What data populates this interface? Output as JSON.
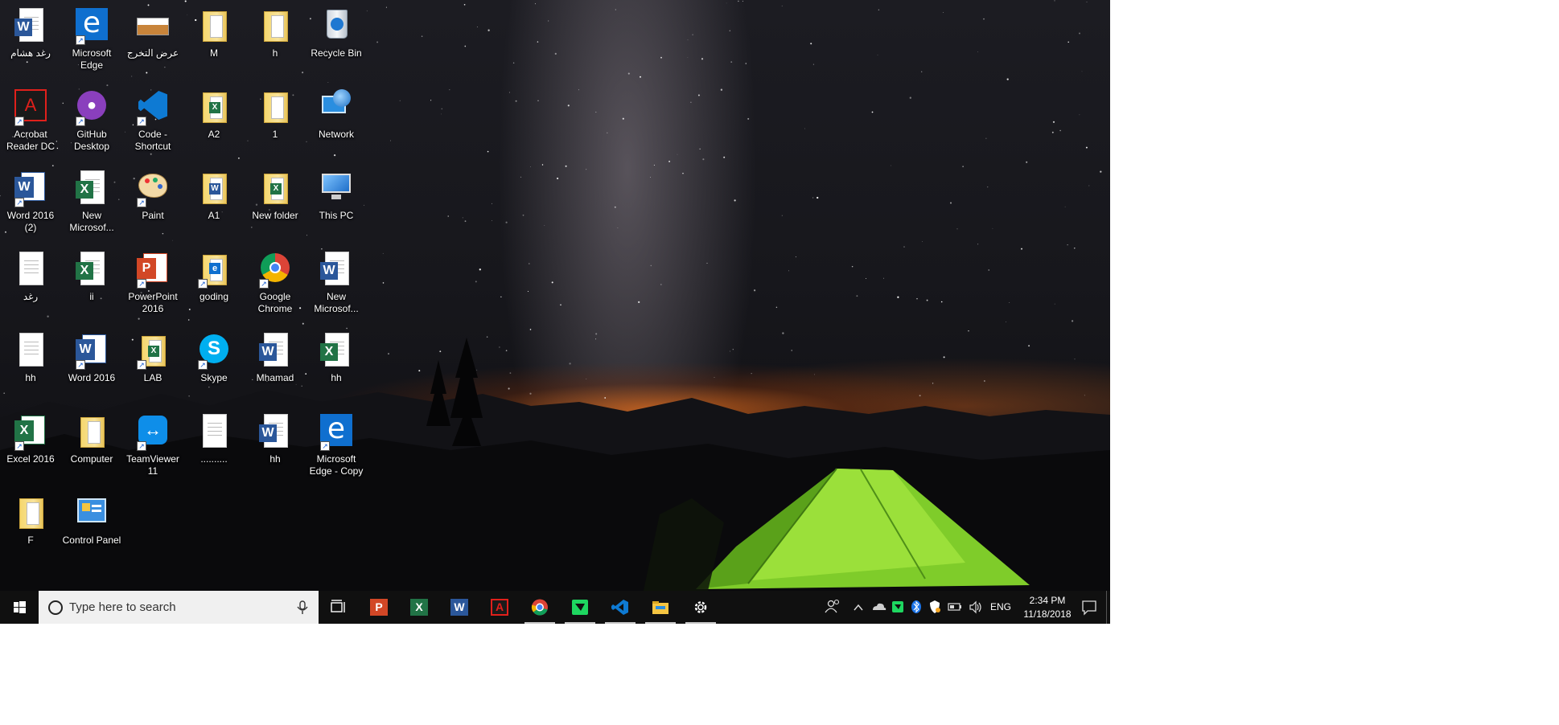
{
  "desktop": {
    "icons": [
      {
        "label": "رغد هشام",
        "kind": "word-doc",
        "icon": "word-document-icon"
      },
      {
        "label": "Microsoft Edge",
        "kind": "edge",
        "icon": "edge-icon",
        "shortcut": true
      },
      {
        "label": "عرض التخرج",
        "kind": "image",
        "icon": "image-file-icon"
      },
      {
        "label": "M",
        "kind": "folder",
        "icon": "folder-icon"
      },
      {
        "label": "h",
        "kind": "folder",
        "icon": "folder-icon"
      },
      {
        "label": "Recycle Bin",
        "kind": "recycle",
        "icon": "recycle-bin-icon"
      },
      {
        "label": "Acrobat Reader DC",
        "kind": "acrobat",
        "icon": "acrobat-reader-icon",
        "shortcut": true
      },
      {
        "label": "GitHub Desktop",
        "kind": "github",
        "icon": "github-desktop-icon",
        "shortcut": true
      },
      {
        "label": "Code - Shortcut",
        "kind": "vscode",
        "icon": "vscode-icon",
        "shortcut": true
      },
      {
        "label": "A2",
        "kind": "folder-excel",
        "icon": "folder-icon"
      },
      {
        "label": "1",
        "kind": "folder",
        "icon": "folder-icon"
      },
      {
        "label": "Network",
        "kind": "network",
        "icon": "network-icon"
      },
      {
        "label": "Word 2016 (2)",
        "kind": "word-app",
        "icon": "word-app-icon",
        "shortcut": true
      },
      {
        "label": "New Microsof...",
        "kind": "excel-doc",
        "icon": "excel-document-icon"
      },
      {
        "label": "Paint",
        "kind": "paint",
        "icon": "paint-icon",
        "shortcut": true
      },
      {
        "label": "A1",
        "kind": "folder-word",
        "icon": "folder-icon"
      },
      {
        "label": "New folder",
        "kind": "folder-excel",
        "icon": "folder-icon"
      },
      {
        "label": "This PC",
        "kind": "thispc",
        "icon": "this-pc-icon"
      },
      {
        "label": "رغد",
        "kind": "text-doc",
        "icon": "text-document-icon"
      },
      {
        "label": "ii",
        "kind": "excel-doc",
        "icon": "excel-document-icon"
      },
      {
        "label": "PowerPoint 2016",
        "kind": "ppt-app",
        "icon": "powerpoint-app-icon",
        "shortcut": true
      },
      {
        "label": "goding",
        "kind": "folder-edge",
        "icon": "folder-icon",
        "shortcut": true
      },
      {
        "label": "Google Chrome",
        "kind": "chrome",
        "icon": "chrome-icon",
        "shortcut": true
      },
      {
        "label": "New Microsof...",
        "kind": "word-doc",
        "icon": "word-document-icon"
      },
      {
        "label": "hh",
        "kind": "text-doc",
        "icon": "text-document-icon"
      },
      {
        "label": "Word 2016",
        "kind": "word-app",
        "icon": "word-app-icon",
        "shortcut": true
      },
      {
        "label": "LAB",
        "kind": "folder-excel",
        "icon": "folder-icon",
        "shortcut": true
      },
      {
        "label": "Skype",
        "kind": "skype",
        "icon": "skype-icon",
        "shortcut": true
      },
      {
        "label": "Mhamad",
        "kind": "word-doc",
        "icon": "word-document-icon"
      },
      {
        "label": "hh",
        "kind": "excel-doc",
        "icon": "excel-document-icon"
      },
      {
        "label": "Excel 2016",
        "kind": "excel-app",
        "icon": "excel-app-icon",
        "shortcut": true
      },
      {
        "label": "Computer",
        "kind": "folder-plain",
        "icon": "folder-icon"
      },
      {
        "label": "TeamViewer 11",
        "kind": "teamviewer",
        "icon": "teamviewer-icon",
        "shortcut": true
      },
      {
        "label": "..........",
        "kind": "text-doc",
        "icon": "text-document-icon"
      },
      {
        "label": "hh",
        "kind": "word-doc",
        "icon": "word-document-icon"
      },
      {
        "label": "Microsoft Edge - Copy",
        "kind": "edge",
        "icon": "edge-icon",
        "shortcut": true
      },
      {
        "label": "F",
        "kind": "folder",
        "icon": "folder-icon"
      },
      {
        "label": "Control Panel",
        "kind": "controlpanel",
        "icon": "control-panel-icon"
      }
    ]
  },
  "taskbar": {
    "search": {
      "placeholder": "Type here to search"
    },
    "apps": [
      {
        "name": "task-view",
        "icon": "task-view-icon",
        "active": false
      },
      {
        "name": "powerpoint",
        "icon": "powerpoint-icon",
        "active": false,
        "color": "#d24726"
      },
      {
        "name": "excel",
        "icon": "excel-icon",
        "active": false,
        "color": "#217346"
      },
      {
        "name": "word",
        "icon": "word-icon",
        "active": false,
        "color": "#2b579a"
      },
      {
        "name": "acrobat",
        "icon": "acrobat-icon",
        "active": false,
        "color": "#e0201b"
      },
      {
        "name": "chrome",
        "icon": "chrome-icon",
        "active": true
      },
      {
        "name": "github-kraken",
        "icon": "green-app-icon",
        "active": true,
        "color": "#1ed760"
      },
      {
        "name": "vscode",
        "icon": "vscode-icon",
        "active": true,
        "color": "#0e7ad3"
      },
      {
        "name": "file-explorer",
        "icon": "file-explorer-icon",
        "active": true,
        "color": "#f5c542"
      },
      {
        "name": "settings",
        "icon": "settings-gear-icon",
        "active": true
      }
    ],
    "tray": {
      "language": "ENG",
      "time": "2:34 PM",
      "date": "11/18/2018"
    }
  },
  "colors": {
    "taskbar": "#101010",
    "search_bg": "#f0f0f0",
    "word": "#2b579a",
    "excel": "#217346",
    "powerpoint": "#d24726"
  }
}
